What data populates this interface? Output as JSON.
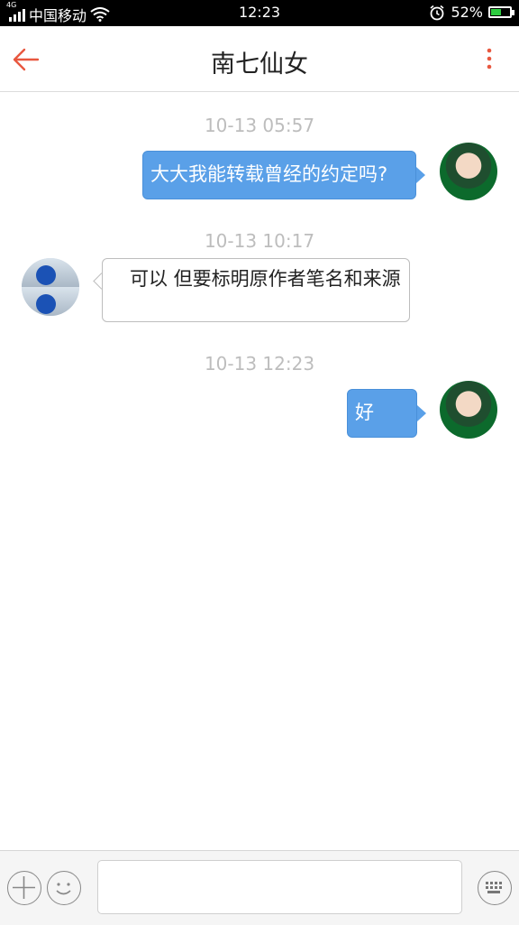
{
  "status_bar": {
    "network": "4G",
    "carrier": "中国移动",
    "time": "12:23",
    "battery": "52%"
  },
  "header": {
    "title": "南七仙女",
    "back_icon": "arrow-left-icon",
    "more_icon": "more-vertical-icon",
    "accent_color": "#e8573f"
  },
  "messages": [
    {
      "timestamp": "10-13  05:57",
      "side": "out",
      "text": "大大我能转载曾经的约定吗?"
    },
    {
      "timestamp": "10-13  10:17",
      "side": "in",
      "text": "　可以  但要标明原作者笔名和来源"
    },
    {
      "timestamp": "10-13  12:23",
      "side": "out",
      "text": "好"
    }
  ],
  "input_bar": {
    "add_icon": "plus-icon",
    "emoji_icon": "smiley-icon",
    "keyboard_icon": "keyboard-icon",
    "message_value": ""
  },
  "colors": {
    "bubble_out": "#5aa0e8",
    "timestamp": "#bdbdbd"
  }
}
